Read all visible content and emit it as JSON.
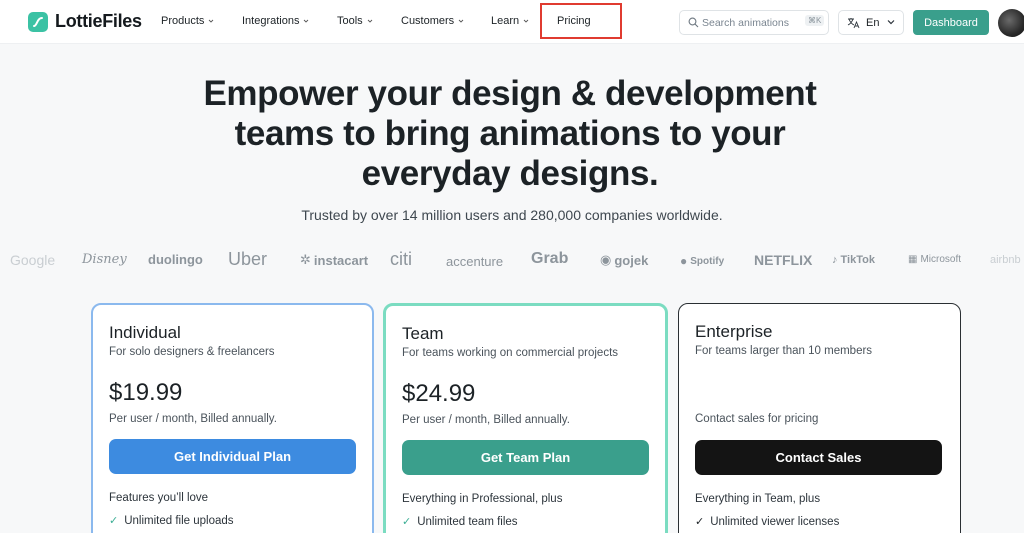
{
  "header": {
    "logo_text": "LottieFiles",
    "nav": [
      {
        "label": "Products"
      },
      {
        "label": "Integrations"
      },
      {
        "label": "Tools"
      },
      {
        "label": "Customers"
      },
      {
        "label": "Learn"
      },
      {
        "label": "Pricing"
      }
    ],
    "search": {
      "placeholder": "Search animations",
      "shortcut": "⌘K"
    },
    "language": {
      "label": "En"
    },
    "dashboard_label": "Dashboard"
  },
  "hero": {
    "title_line1": "Empower your design & development",
    "title_line2": "teams to bring animations to your",
    "title_line3": "everyday designs.",
    "subtitle": "Trusted by over 14 million users and 280,000 companies worldwide."
  },
  "brands": [
    {
      "name": "Google"
    },
    {
      "name": "Disney"
    },
    {
      "name": "duolingo"
    },
    {
      "name": "Uber"
    },
    {
      "name": "instacart"
    },
    {
      "name": "citi"
    },
    {
      "name": "accenture"
    },
    {
      "name": "Grab"
    },
    {
      "name": "gojek"
    },
    {
      "name": "Spotify"
    },
    {
      "name": "NETFLIX"
    },
    {
      "name": "TikTok"
    },
    {
      "name": "Microsoft"
    },
    {
      "name": "airbnb"
    }
  ],
  "plans": [
    {
      "name": "Individual",
      "description": "For solo designers & freelancers",
      "price": "$19.99",
      "billing": "Per user / month, Billed annually.",
      "button_label": "Get Individual Plan",
      "features_heading": "Features you’ll love",
      "first_feature": "Unlimited file uploads",
      "button_color": "#3d8be0"
    },
    {
      "name": "Team",
      "description": "For teams working on commercial projects",
      "price": "$24.99",
      "billing": "Per user / month, Billed annually.",
      "button_label": "Get Team Plan",
      "features_heading": "Everything in Professional, plus",
      "first_feature": "Unlimited team files",
      "button_color": "#3a9f8c"
    },
    {
      "name": "Enterprise",
      "description": "For teams larger than 10 members",
      "price": "",
      "billing": "Contact sales for pricing",
      "button_label": "Contact Sales",
      "features_heading": "Everything in Team, plus",
      "first_feature": "Unlimited viewer licenses",
      "button_color": "#141414"
    }
  ],
  "colors": {
    "accent": "#3a9f8c",
    "brand_logo": "#3bc2a4",
    "highlight_box": "#e03b30"
  }
}
